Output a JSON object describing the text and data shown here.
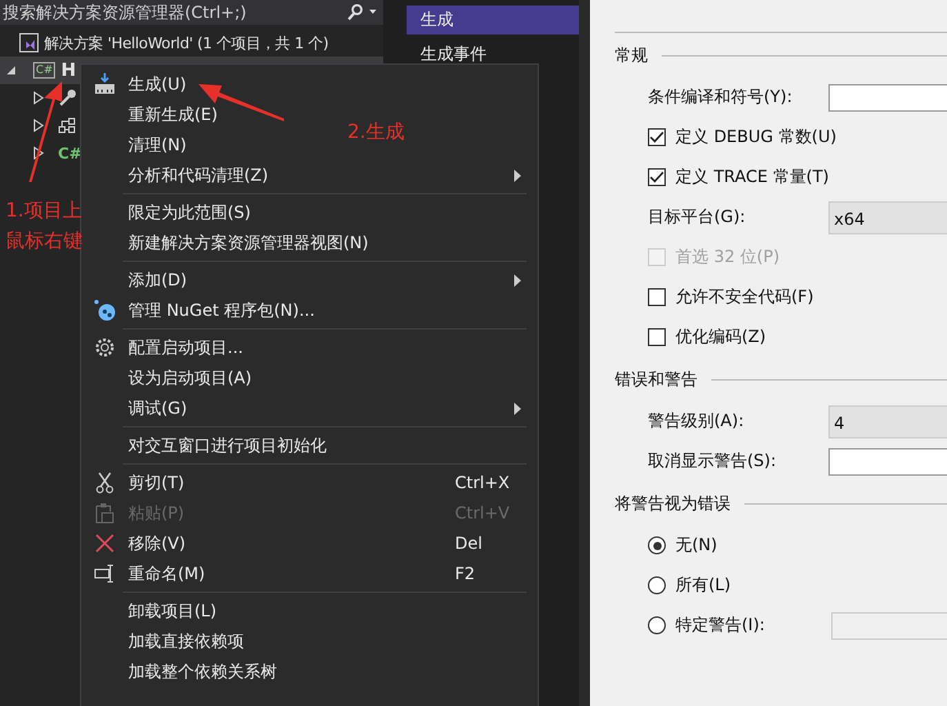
{
  "search": {
    "placeholder": "搜索解决方案资源管理器(Ctrl+;)"
  },
  "solution_explorer": {
    "solution": {
      "label": "解决方案 'HelloWorld' (1 个项目，共 1 个)"
    },
    "project": {
      "label": "H",
      "icon_text": "C#",
      "expanded": true,
      "selected": true,
      "children": [
        {
          "kind": "properties",
          "expanded": false
        },
        {
          "kind": "dependencies",
          "expanded": false
        },
        {
          "kind": "file",
          "icon_text": "C#",
          "expanded": false
        }
      ]
    }
  },
  "context_menu": {
    "groups": [
      [
        {
          "kind": "build",
          "label": "生成(U)"
        },
        {
          "kind": "plain",
          "label": "重新生成(E)"
        },
        {
          "kind": "plain",
          "label": "清理(N)"
        },
        {
          "kind": "plain",
          "label": "分析和代码清理(Z)",
          "submenu": true
        }
      ],
      [
        {
          "kind": "plain",
          "label": "限定为此范围(S)"
        },
        {
          "kind": "plain",
          "label": "新建解决方案资源管理器视图(N)"
        }
      ],
      [
        {
          "kind": "plain",
          "label": "添加(D)",
          "submenu": true
        },
        {
          "kind": "nuget",
          "label": "管理 NuGet 程序包(N)..."
        }
      ],
      [
        {
          "kind": "settings",
          "label": "配置启动项目..."
        },
        {
          "kind": "plain",
          "label": "设为启动项目(A)"
        },
        {
          "kind": "plain",
          "label": "调试(G)",
          "submenu": true
        }
      ],
      [
        {
          "kind": "plain",
          "label": "对交互窗口进行项目初始化"
        }
      ],
      [
        {
          "kind": "cut",
          "label": "剪切(T)",
          "shortcut": "Ctrl+X"
        },
        {
          "kind": "paste",
          "label": "粘贴(P)",
          "shortcut": "Ctrl+V",
          "disabled": true
        },
        {
          "kind": "remove",
          "label": "移除(V)",
          "shortcut": "Del"
        },
        {
          "kind": "rename",
          "label": "重命名(M)",
          "shortcut": "F2"
        }
      ],
      [
        {
          "kind": "plain",
          "label": "卸载项目(L)"
        },
        {
          "kind": "plain",
          "label": "加载直接依赖项"
        },
        {
          "kind": "plain",
          "label": "加载整个依赖关系树"
        }
      ]
    ]
  },
  "annotations": [
    {
      "kind": "step1",
      "text": "1.项目上鼠标右键"
    },
    {
      "kind": "step2",
      "text": "2.生成"
    }
  ],
  "page_nav": {
    "items": [
      {
        "label": "生成",
        "selected": true
      },
      {
        "label": "生成事件",
        "selected": false
      }
    ]
  },
  "build_page": {
    "sections": [
      {
        "title": "常规",
        "rows": [
          {
            "kind": "field",
            "label": "条件编译和符号(Y):"
          },
          {
            "kind": "checkbox",
            "label": "定义 DEBUG 常数(U)",
            "checked": true,
            "disabled": false
          },
          {
            "kind": "checkbox",
            "label": "定义 TRACE 常量(T)",
            "checked": true,
            "disabled": false
          },
          {
            "kind": "dropdown",
            "label": "目标平台(G):",
            "value": "x64"
          },
          {
            "kind": "checkbox",
            "label": "首选 32 位(P)",
            "checked": false,
            "disabled": true
          },
          {
            "kind": "checkbox",
            "label": "允许不安全代码(F)",
            "checked": false,
            "disabled": false
          },
          {
            "kind": "checkbox",
            "label": "优化编码(Z)",
            "checked": false,
            "disabled": false
          }
        ]
      },
      {
        "title": "错误和警告",
        "rows": [
          {
            "kind": "dropdown",
            "label": "警告级别(A):",
            "value": "4"
          },
          {
            "kind": "field",
            "label": "取消显示警告(S):"
          }
        ]
      },
      {
        "title": "将警告视为错误",
        "rows": [
          {
            "kind": "radio",
            "label": "无(N)",
            "selected": true
          },
          {
            "kind": "radio",
            "label": "所有(L)",
            "selected": false
          },
          {
            "kind": "radio",
            "label": "特定警告(I):",
            "selected": false,
            "has_field": true
          }
        ]
      }
    ]
  }
}
